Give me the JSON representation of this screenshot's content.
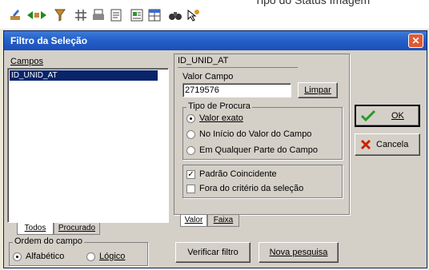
{
  "toolbar": {
    "icons": [
      "edit-icon",
      "nav-arrows-icon",
      "filter-icon",
      "grid-icon",
      "print-icon",
      "print-preview-icon",
      "report-icon",
      "table-icon",
      "binoculars-icon",
      "help-pointer-icon"
    ],
    "cut_text": "Tipo do Status Imagem"
  },
  "dialog": {
    "title": "Filtro da Seleção",
    "close_glyph": "✕"
  },
  "campos": {
    "label": "Campos",
    "items": [
      "ID_UNID_AT"
    ],
    "tabs": [
      "Todos",
      "Procurado"
    ]
  },
  "field_name": "ID_UNID_AT",
  "valor": {
    "label": "Valor Campo",
    "value": "2719576",
    "limpar_label": "Limpar"
  },
  "tipo_procura": {
    "title": "Tipo de Procura",
    "options": [
      "Valor exato",
      "No Início do Valor do Campo",
      "Em Qualquer Parte do Campo"
    ],
    "selected": 0
  },
  "checks": {
    "padrao": {
      "label": "Padrão Coincidente",
      "checked": true
    },
    "fora": {
      "label": "Fora do critério da seleção",
      "checked": false
    }
  },
  "detail_tabs": [
    "Valor",
    "Faixa"
  ],
  "ordem": {
    "title": "Ordem do campo",
    "options": [
      "Alfabético",
      "Lógico"
    ],
    "selected": 0
  },
  "buttons": {
    "verificar": "Verificar filtro",
    "nova": "Nova pesquisa",
    "ok": "OK",
    "cancela": "Cancela"
  },
  "colors": {
    "title_bar": "#2561c9",
    "selection": "#0a246a",
    "ok_check": "#2a9a2a",
    "cancel_x": "#cc2200"
  }
}
